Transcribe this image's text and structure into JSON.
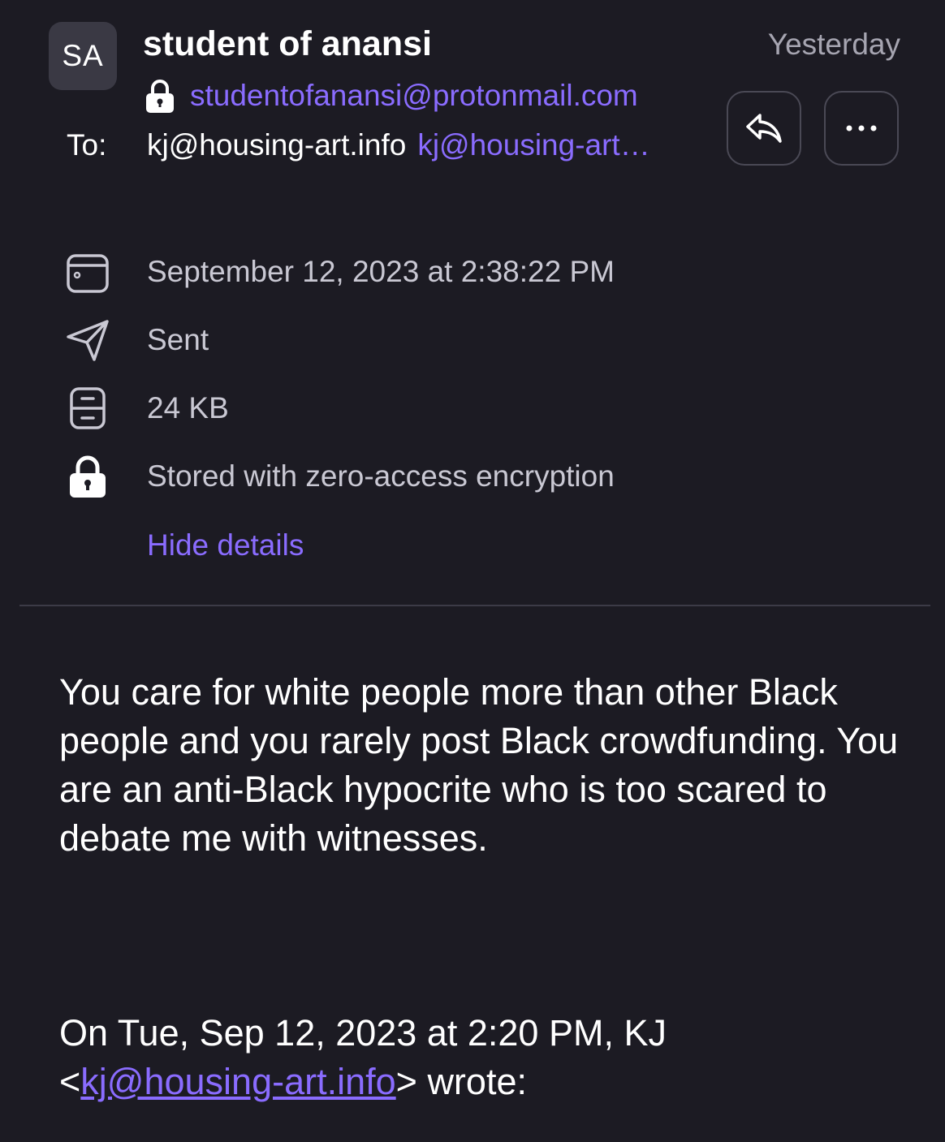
{
  "sender": {
    "initials": "SA",
    "name": "student of anansi",
    "email": "studentofanansi@protonmail.com",
    "time": "Yesterday"
  },
  "recipient": {
    "label": "To:",
    "name": "kj@housing-art.info",
    "address": "kj@housing-art…"
  },
  "actions": {
    "reply_icon": "reply-icon",
    "more_icon": "more-icon",
    "more_label": "···"
  },
  "details": {
    "date": "September 12, 2023 at 2:38:22 PM",
    "folder": "Sent",
    "size": "24 KB",
    "encryption": "Stored with zero-access encryption",
    "hide_label": "Hide details"
  },
  "message": {
    "body": "You care for white people more than other Black people and you rarely post Black crowdfunding. You are an anti-Black hypocrite who is too scared to debate me with witnesses.",
    "quote_prefix": "On Tue, Sep 12, 2023 at 2:20 PM, KJ",
    "quote_open": "<",
    "quote_email": "kj@housing-art.info",
    "quote_suffix": "> wrote:"
  },
  "colors": {
    "background": "#1c1b23",
    "accent": "#8a6cff",
    "muted_text": "#c9c8d3"
  }
}
